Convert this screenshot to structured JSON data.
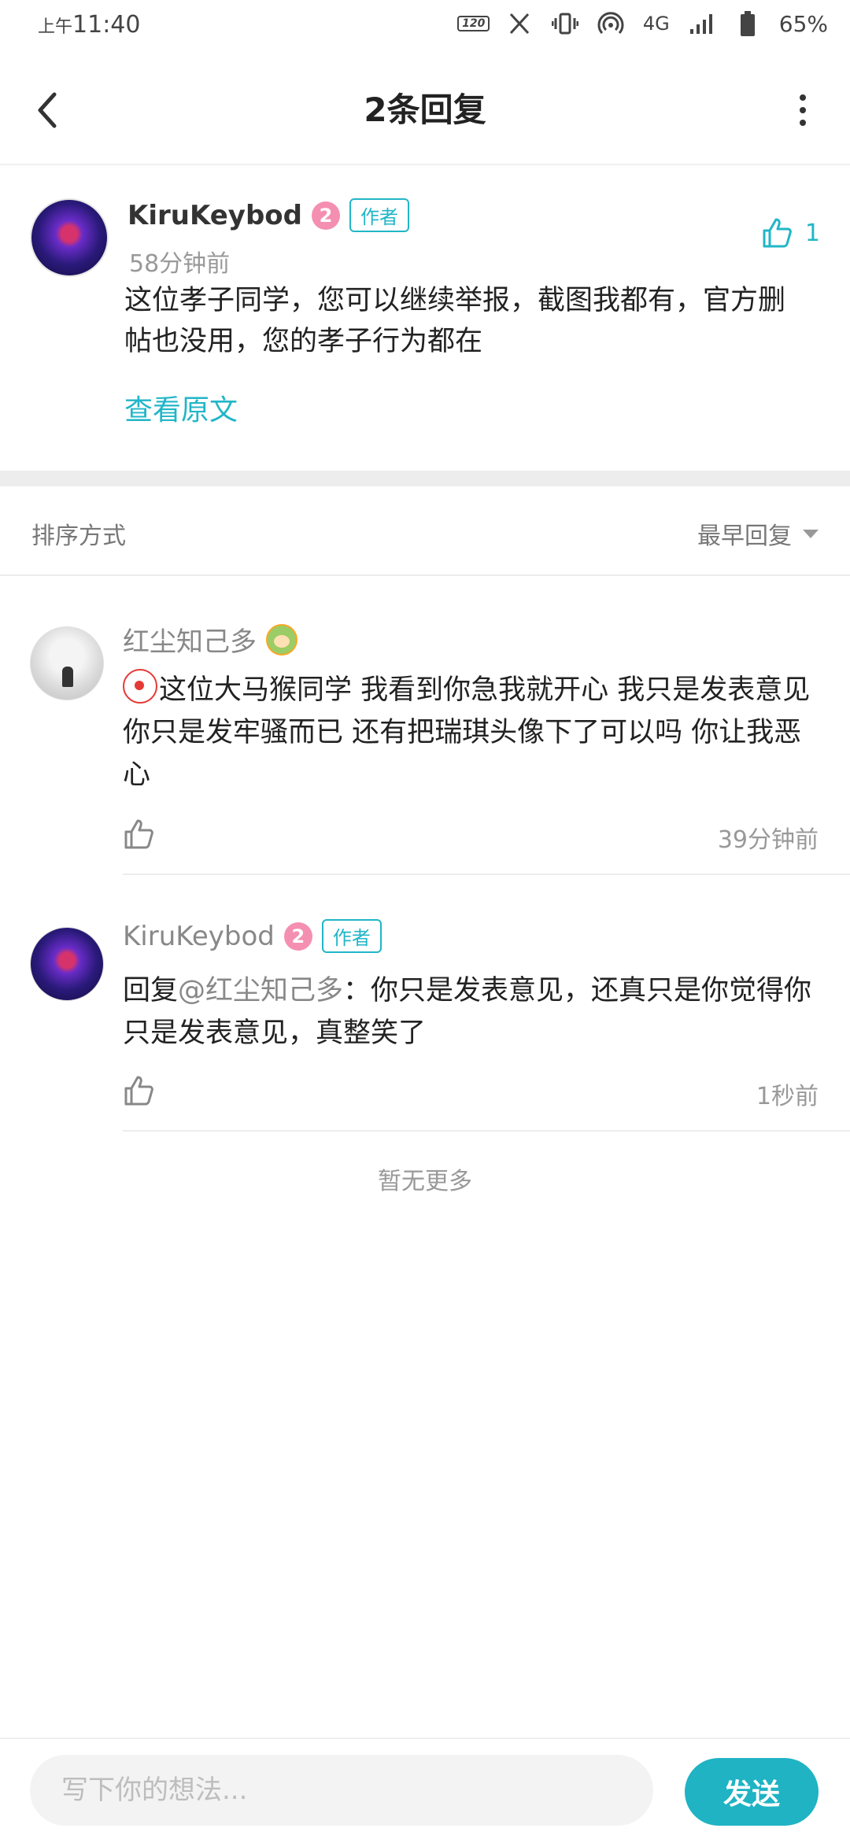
{
  "status_bar": {
    "time_prefix": "上午",
    "time": "11:40",
    "refresh_rate": "120",
    "network": "4G",
    "battery": "65%"
  },
  "header": {
    "title": "2条回复"
  },
  "main_comment": {
    "author": "KiruKeybod",
    "level": "2",
    "author_tag": "作者",
    "time": "58分钟前",
    "likes": "1",
    "text": "这位孝子同学，您可以继续举报，截图我都有，官方删帖也没用，您的孝子行为都在",
    "view_original": "查看原文"
  },
  "sort": {
    "label": "排序方式",
    "value": "最早回复"
  },
  "replies": [
    {
      "author": "红尘知己多",
      "text": "这位大马猴同学 我看到你急我就开心 我只是发表意见 你只是发牢骚而已 还有把瑞琪头像下了可以吗 你让我恶心",
      "time": "39分钟前"
    },
    {
      "author": "KiruKeybod",
      "level": "2",
      "author_tag": "作者",
      "reply_prefix": "回复",
      "mention": "@红尘知己多",
      "text": "：你只是发表意见，还真只是你觉得你只是发表意见，真整笑了",
      "time": "1秒前"
    }
  ],
  "footer_note": "暂无更多",
  "composer": {
    "placeholder": "写下你的想法...",
    "send_label": "发送"
  },
  "colors": {
    "accent": "#21b6c7",
    "send_button": "#1fb3c4",
    "level_badge": "#f48fb1"
  }
}
